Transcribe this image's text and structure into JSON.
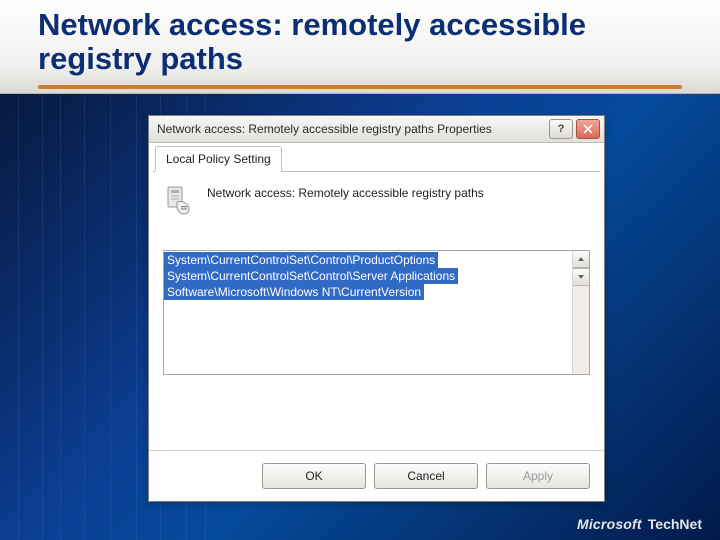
{
  "slide": {
    "title": "Network access: remotely accessible registry paths"
  },
  "dialog": {
    "title": "Network access: Remotely accessible registry paths Properties",
    "tab_label": "Local Policy Setting",
    "policy_label": "Network access: Remotely accessible registry paths",
    "registry_paths": [
      "System\\CurrentControlSet\\Control\\ProductOptions",
      "System\\CurrentControlSet\\Control\\Server Applications",
      "Software\\Microsoft\\Windows NT\\CurrentVersion"
    ],
    "buttons": {
      "ok": "OK",
      "cancel": "Cancel",
      "apply": "Apply"
    }
  },
  "footer": {
    "microsoft": "Microsoft",
    "technet": "TechNet"
  }
}
